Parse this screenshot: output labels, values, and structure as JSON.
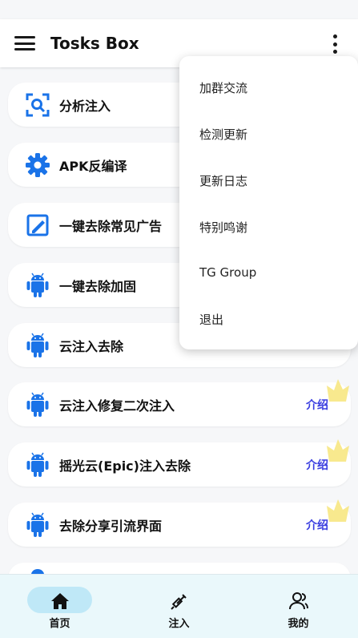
{
  "app": {
    "title": "Tosks Box"
  },
  "list": [
    {
      "icon": "search-scan-icon",
      "label": "分析注入",
      "intro": ""
    },
    {
      "icon": "gear-icon",
      "label": "APK反编译",
      "intro": ""
    },
    {
      "icon": "edit-box-icon",
      "label": "一键去除常见广告",
      "intro": ""
    },
    {
      "icon": "android-icon",
      "label": "一键去除加固",
      "intro": ""
    },
    {
      "icon": "android-icon",
      "label": "云注入去除",
      "intro": ""
    },
    {
      "icon": "android-icon",
      "label": "云注入修复二次注入",
      "intro": "介绍"
    },
    {
      "icon": "android-icon",
      "label": "摇光云(Epic)注入去除",
      "intro": "介绍"
    },
    {
      "icon": "android-icon",
      "label": "去除分享引流界面",
      "intro": "介绍"
    }
  ],
  "popup_menu": [
    "加群交流",
    "检测更新",
    "更新日志",
    "特别鸣谢",
    "TG Group",
    "退出"
  ],
  "bottom_nav": [
    {
      "icon": "home-icon",
      "label": "首页",
      "selected": true
    },
    {
      "icon": "syringe-icon",
      "label": "注入",
      "selected": false
    },
    {
      "icon": "user-icon",
      "label": "我的",
      "selected": false
    }
  ],
  "colors": {
    "accent_blue": "#1a73e8",
    "intro_text": "#3a3ee0",
    "nav_background": "#eaf8fb",
    "nav_selected_pill": "#bfe8f7",
    "decoration_yellow": "#f7e57a"
  }
}
